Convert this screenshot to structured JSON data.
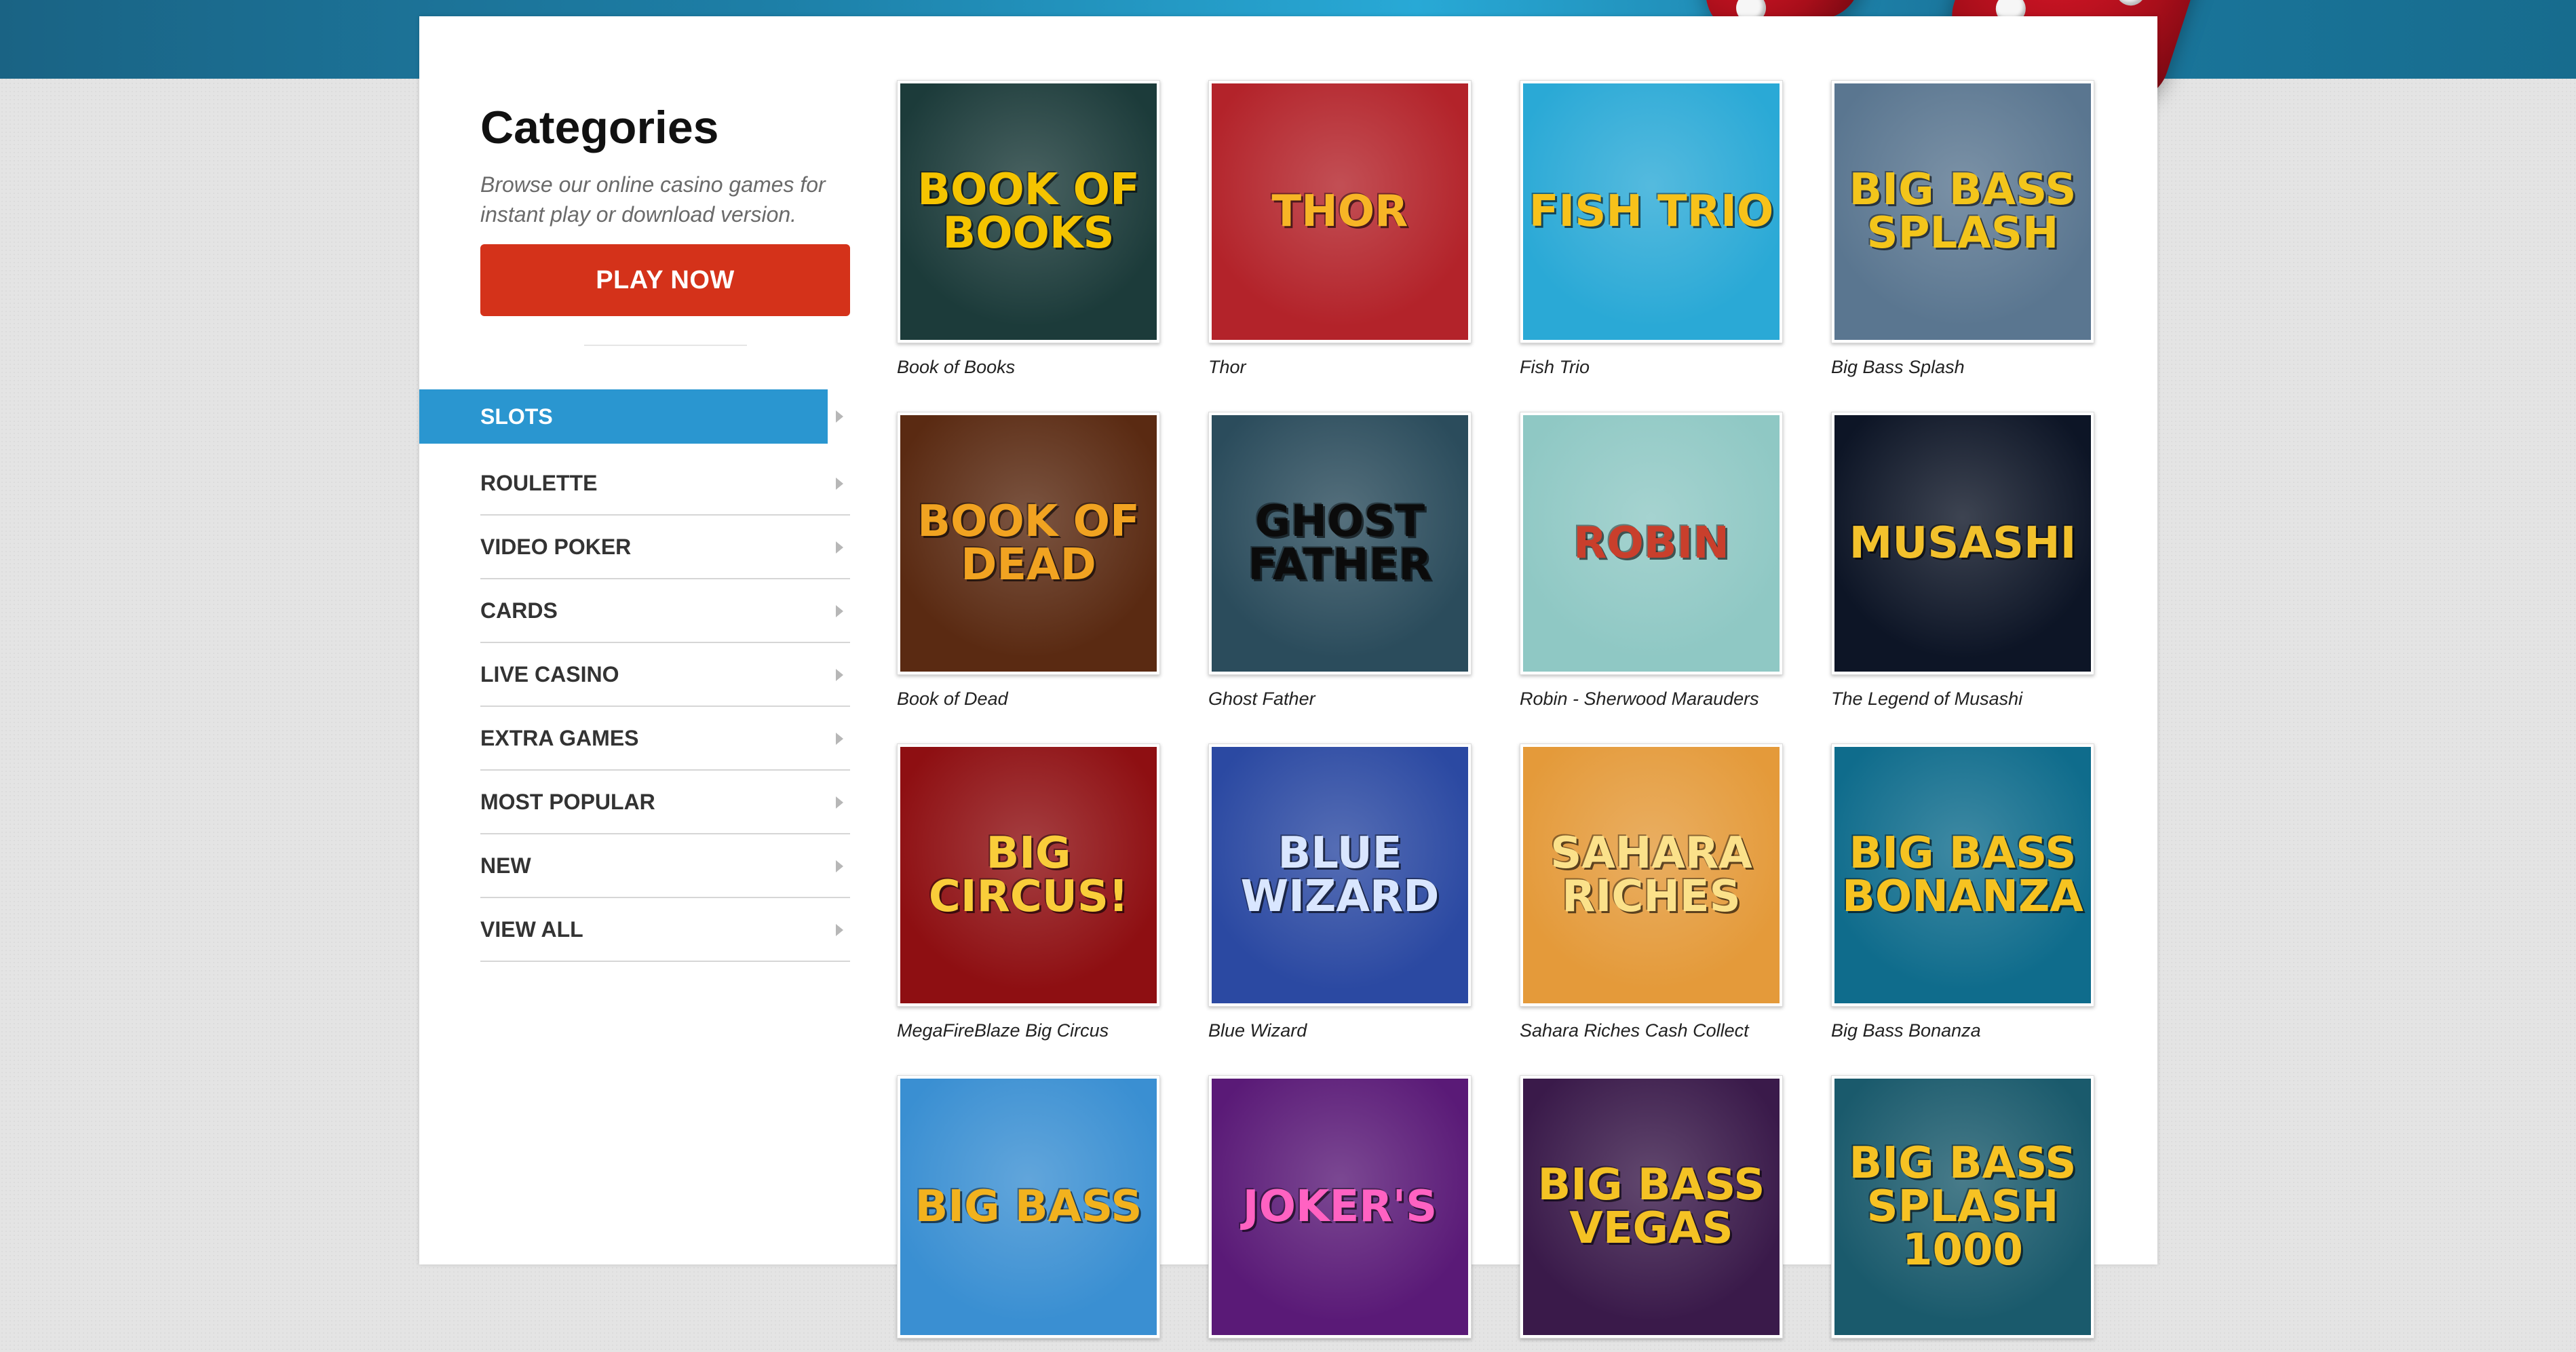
{
  "sidebar": {
    "title": "Categories",
    "description": "Browse our online casino games for instant play or download version.",
    "play_button": "PLAY NOW",
    "menu": [
      {
        "label": "SLOTS",
        "active": true
      },
      {
        "label": "ROULETTE"
      },
      {
        "label": "VIDEO POKER"
      },
      {
        "label": "CARDS"
      },
      {
        "label": "LIVE CASINO"
      },
      {
        "label": "EXTRA GAMES"
      },
      {
        "label": "MOST POPULAR"
      },
      {
        "label": "NEW"
      },
      {
        "label": "VIEW ALL"
      }
    ]
  },
  "games": [
    {
      "name": "Book of Books",
      "art": "BOOK OF BOOKS",
      "bg": "#1c3b3a",
      "fg": "#f5c400"
    },
    {
      "name": "Thor",
      "art": "THOR",
      "bg": "#b3232a",
      "fg": "#f7b526"
    },
    {
      "name": "Fish Trio",
      "art": "FISH TRIO",
      "bg": "#2aa9d6",
      "fg": "#f7c21a"
    },
    {
      "name": "Big Bass Splash",
      "art": "BIG BASS SPLASH",
      "bg": "#5a7690",
      "fg": "#f3c51b"
    },
    {
      "name": "Book of Dead",
      "art": "BOOK OF DEAD",
      "bg": "#5a2a12",
      "fg": "#f1a321"
    },
    {
      "name": "Ghost Father",
      "art": "GHOST FATHER",
      "bg": "#2b4c5c",
      "fg": "#0b0b0b"
    },
    {
      "name": "Robin - Sherwood Marauders",
      "art": "ROBIN",
      "bg": "#8fc8c4",
      "fg": "#c93f2c"
    },
    {
      "name": "The Legend of Musashi",
      "art": "MUSASHI",
      "bg": "#0d1526",
      "fg": "#f2c12c"
    },
    {
      "name": "MegaFireBlaze Big Circus",
      "art": "BIG CIRCUS!",
      "bg": "#8e0f12",
      "fg": "#f9cd3a"
    },
    {
      "name": "Blue Wizard",
      "art": "BLUE WIZARD",
      "bg": "#2b49a2",
      "fg": "#d9e6ff"
    },
    {
      "name": "Sahara Riches Cash Collect",
      "art": "SAHARA RICHES",
      "bg": "#e49a3a",
      "fg": "#fbe18a"
    },
    {
      "name": "Big Bass Bonanza",
      "art": "BIG BASS BONANZA",
      "bg": "#0f6c8c",
      "fg": "#f6c321"
    },
    {
      "name": "",
      "art": "BIG BASS",
      "bg": "#3a8fd2",
      "fg": "#f2b21e"
    },
    {
      "name": "",
      "art": "JOKER'S",
      "bg": "#5a1a77",
      "fg": "#ff62c2"
    },
    {
      "name": "",
      "art": "BIG BASS VEGAS",
      "bg": "#3a1a4a",
      "fg": "#f4c224"
    },
    {
      "name": "",
      "art": "BIG BASS SPLASH 1000",
      "bg": "#1a5a6c",
      "fg": "#f6c223"
    }
  ]
}
